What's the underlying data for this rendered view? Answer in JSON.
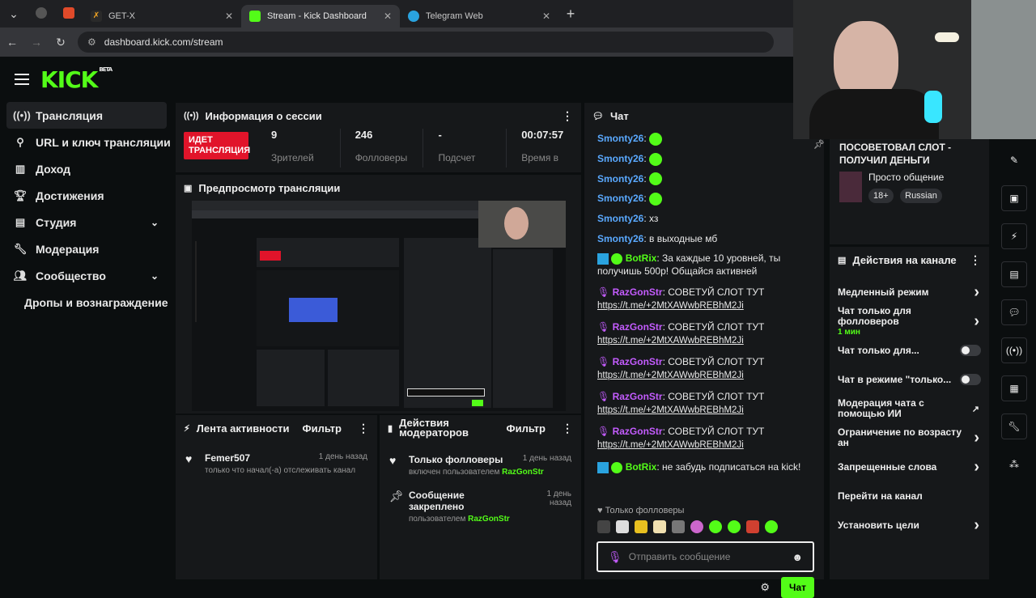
{
  "browser": {
    "tabs": [
      {
        "label": "GET-X",
        "active": false
      },
      {
        "label": "Stream - Kick Dashboard",
        "active": true
      },
      {
        "label": "Telegram Web",
        "active": false
      }
    ],
    "url": "dashboard.kick.com/stream"
  },
  "app": {
    "logo": "KICK",
    "beta": "BETA"
  },
  "sidebar": {
    "items": [
      {
        "label": "Трансляция",
        "icon": "broadcast-icon"
      },
      {
        "label": "URL и ключ трансляции",
        "icon": "link-icon"
      },
      {
        "label": "Доход",
        "icon": "chart-icon"
      },
      {
        "label": "Достижения",
        "icon": "trophy-icon"
      },
      {
        "label": "Студия",
        "icon": "studio-icon"
      },
      {
        "label": "Модерация",
        "icon": "wrench-icon"
      },
      {
        "label": "Сообщество",
        "icon": "people-icon"
      },
      {
        "label": "Дропы и вознаграждение",
        "icon": ""
      }
    ]
  },
  "session": {
    "title": "Информация о сессии",
    "live_badge": "ИДЕТ ТРАНСЛЯЦИЯ",
    "stats": [
      {
        "value": "9",
        "label": "Зрителей"
      },
      {
        "value": "246",
        "label": "Фолловеры"
      },
      {
        "value": "-",
        "label": "Подсчет"
      },
      {
        "value": "00:07:57",
        "label": "Время в"
      }
    ]
  },
  "preview": {
    "title": "Предпросмотр трансляции"
  },
  "activity": {
    "title": "Лента активности",
    "filter": "Фильтр",
    "items": [
      {
        "name": "Femer507",
        "desc": "только что начал(-а) отслеживать канал",
        "time": "1 день назад"
      }
    ]
  },
  "mod_actions": {
    "title": "Действия модераторов",
    "filter": "Фильтр",
    "items": [
      {
        "name": "Только фолловеры",
        "desc": "включен пользователем",
        "user": "RazGonStr",
        "time": "1 день назад"
      },
      {
        "name": "Сообщение закреплено",
        "desc": "пользователем",
        "user": "RazGonStr",
        "time": "1 день назад"
      }
    ]
  },
  "chat": {
    "title": "Чат",
    "messages": [
      {
        "user": "Smonty26",
        "text": "",
        "emoji": true,
        "color": "#5aa9ff"
      },
      {
        "user": "Smonty26",
        "text": "",
        "emoji": true,
        "color": "#5aa9ff"
      },
      {
        "user": "Smonty26",
        "text": "",
        "emoji": true,
        "color": "#5aa9ff"
      },
      {
        "user": "Smonty26",
        "text": "",
        "emoji": true,
        "color": "#5aa9ff"
      },
      {
        "user": "Smonty26",
        "text": "хз",
        "emoji": false,
        "color": "#5aa9ff"
      },
      {
        "user": "Smonty26",
        "text": "в выходные мб",
        "emoji": false,
        "color": "#5aa9ff"
      }
    ],
    "bot1": {
      "user": "BotRix",
      "text": "За каждые 10 уровней, ты получишь 500р! Общайся активней"
    },
    "spam": [
      {
        "user": "RazGonStr",
        "text": "СОВЕТУЙ СЛОТ ТУТ",
        "link": "https://t.me/+2MtXAWwbREBhM2Ji"
      },
      {
        "user": "RazGonStr",
        "text": "СОВЕТУЙ СЛОТ ТУТ",
        "link": "https://t.me/+2MtXAWwbREBhM2Ji"
      },
      {
        "user": "RazGonStr",
        "text": "СОВЕТУЙ СЛОТ ТУТ",
        "link": "https://t.me/+2MtXAWwbREBhM2Ji"
      },
      {
        "user": "RazGonStr",
        "text": "СОВЕТУЙ СЛОТ ТУТ",
        "link": "https://t.me/+2MtXAWwbREBhM2Ji"
      },
      {
        "user": "RazGonStr",
        "text": "СОВЕТУЙ СЛОТ ТУТ",
        "link": "https://t.me/+2MtXAWwbREBhM2Ji"
      }
    ],
    "bot2": {
      "user": "BotRix",
      "text": "не забудь подписаться на kick!"
    },
    "followers_only": "Только фолловеры",
    "input_placeholder": "Отправить сообщение",
    "send_label": "Чат",
    "colors": {
      "mod": "#c45cff",
      "user": "#5aa9ff",
      "bot": "#53fc18"
    }
  },
  "stream_info": {
    "title": "ПОСОВЕТОВАЛ СЛОТ - ПОЛУЧИЛ ДЕНЬГИ",
    "category": "Просто общение",
    "tags": [
      "18+",
      "Russian"
    ]
  },
  "channel_actions": {
    "title": "Действия на канале",
    "items": [
      {
        "label": "Медленный режим",
        "control": "chevron"
      },
      {
        "label": "Чат только для фолловеров",
        "sub": "1 мин",
        "control": "chevron"
      },
      {
        "label": "Чат только для...",
        "control": "toggle"
      },
      {
        "label": "Чат в режиме \"только...",
        "control": "toggle"
      },
      {
        "label": "Модерация чата с помощью ИИ",
        "control": "external"
      },
      {
        "label": "Ограничение по возрасту ан",
        "control": "chevron"
      },
      {
        "label": "Запрещенные слова",
        "control": "chevron"
      },
      {
        "label": "Перейти на канал",
        "control": "none"
      },
      {
        "label": "Установить цели",
        "control": "chevron"
      }
    ]
  },
  "theme": {
    "accent": "#53fc18",
    "live": "#e1142a"
  }
}
